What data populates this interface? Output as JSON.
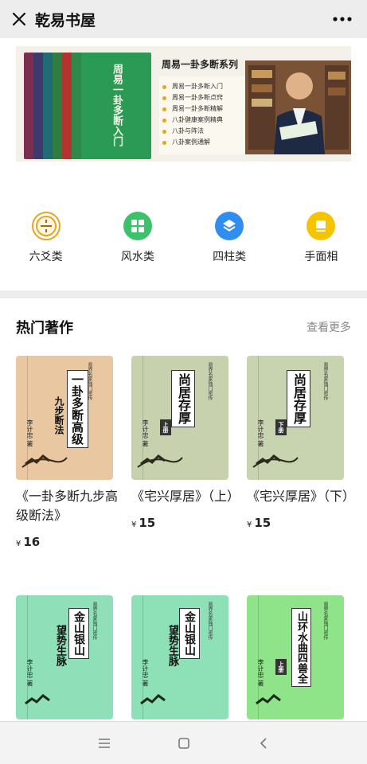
{
  "header": {
    "title": "乾易书屋"
  },
  "banner": {
    "series_title": "周易一卦多断系列",
    "items": [
      "周易一卦多断入门",
      "周易一卦多断点窍",
      "周易一卦多断精解",
      "八卦健康案例精典",
      "八卦与阵法",
      "八卦案例通解"
    ],
    "cover_text": "周易一卦多断入门"
  },
  "categories": [
    {
      "label": "六爻类",
      "icon": "liuyao-seal-icon",
      "color": "#e8a51c"
    },
    {
      "label": "风水类",
      "icon": "grid-four-icon",
      "color": "#3cc26a"
    },
    {
      "label": "四柱类",
      "icon": "layers-icon",
      "color": "#2f8ef0"
    },
    {
      "label": "手面相",
      "icon": "book-icon",
      "color": "#f5c400"
    }
  ],
  "section": {
    "title": "热门著作",
    "more": "查看更多"
  },
  "books": [
    {
      "name": "《一卦多断九步高级断法》",
      "price": "16",
      "cover_title_1": "一卦多断高级",
      "cover_title_2": "九步断法",
      "author": "李计忠 著",
      "cover_color": "#e9c7a0"
    },
    {
      "name": "《宅兴厚居》（上）",
      "price": "15",
      "cover_title_1": "尚居存厚",
      "cover_title_2": "上册",
      "author": "李计忠 著",
      "cover_color": "#c7d1ad"
    },
    {
      "name": "《宅兴厚居》（下）",
      "price": "15",
      "cover_title_1": "尚居存厚",
      "cover_title_2": "下册",
      "author": "李计忠 著",
      "cover_color": "#c8d3af"
    },
    {
      "name": "",
      "price": "",
      "cover_title_1": "金山银山",
      "cover_title_2": "望势生脉",
      "author": "李计忠 著",
      "cover_color": "#8fe0b8"
    },
    {
      "name": "",
      "price": "",
      "cover_title_1": "金山银山",
      "cover_title_2": "望势生脉",
      "author": "李计忠 著",
      "cover_color": "#8ee0b6"
    },
    {
      "name": "",
      "price": "",
      "cover_title_1": "山环水曲四兽全",
      "cover_title_2": "上册",
      "author": "李计忠 著",
      "cover_color": "#8fe48a"
    }
  ],
  "cover_common": {
    "publisher_line": "易界名家独门密传",
    "price_symbol": "¥"
  }
}
